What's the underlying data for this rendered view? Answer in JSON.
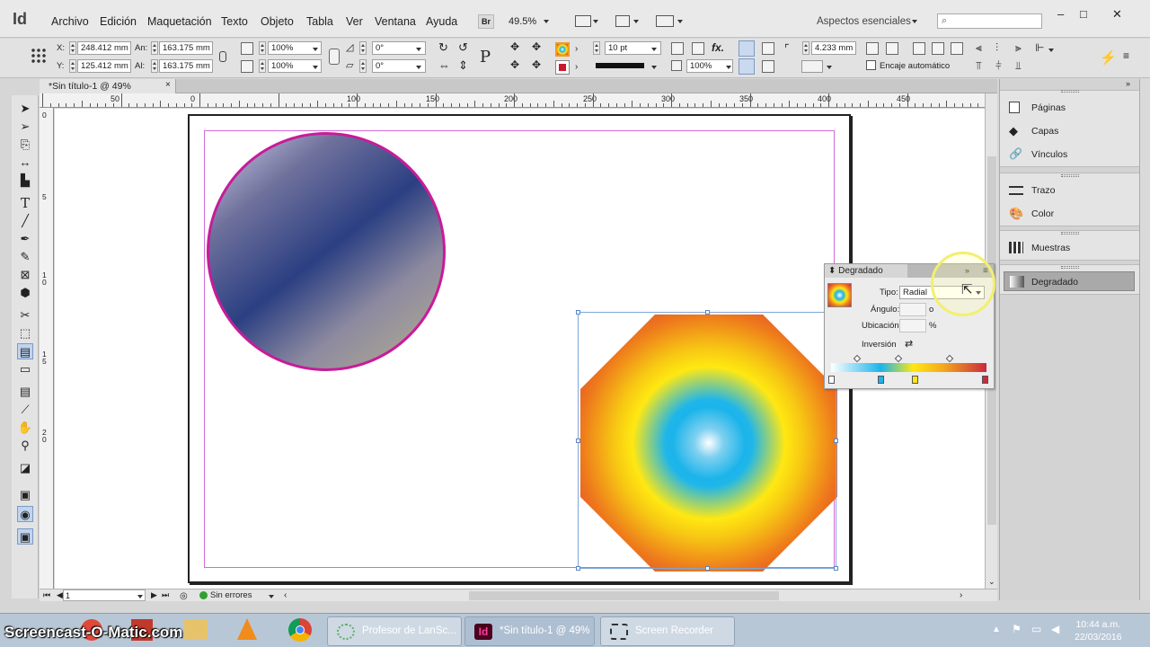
{
  "app": {
    "logo": "Id"
  },
  "menu": [
    "Archivo",
    "Edición",
    "Maquetación",
    "Texto",
    "Objeto",
    "Tabla",
    "Ver",
    "Ventana",
    "Ayuda"
  ],
  "menubar": {
    "bridge": "Br",
    "zoom": "49.5%",
    "workspace": "Aspectos esenciales",
    "search_placeholder": ""
  },
  "window_controls": {
    "minimize": "–",
    "maximize": "□",
    "close": "✕"
  },
  "control": {
    "x_label": "X:",
    "x_value": "248.412 mm",
    "y_label": "Y:",
    "y_value": "125.412 mm",
    "w_label": "An:",
    "w_value": "163.175 mm",
    "h_label": "Al:",
    "h_value": "163.175 mm",
    "scale_x": "100%",
    "scale_y": "100%",
    "rotate": "0°",
    "shear": "0°",
    "stroke_weight": "10 pt",
    "opacity": "100%",
    "offset": "4.233 mm",
    "autofit_label": "Encaje automático"
  },
  "document_tab": "*Sin título-1 @ 49%",
  "ruler_labels": [
    "0",
    "50",
    "100",
    "150",
    "200",
    "250",
    "300",
    "350",
    "400",
    "450"
  ],
  "vruler_labels": [
    "0",
    "5",
    "1 0",
    "1 5",
    "2 0"
  ],
  "status": {
    "page": "1",
    "preflight": "Sin errores"
  },
  "panels": {
    "group1": [
      "Páginas",
      "Capas",
      "Vínculos"
    ],
    "group2": [
      "Trazo",
      "Color"
    ],
    "group3": [
      "Muestras"
    ],
    "group4": [
      "Degradado"
    ]
  },
  "gradient_panel": {
    "title": "Degradado",
    "type_label": "Tipo:",
    "type_value": "Radial",
    "angle_label": "Ángulo:",
    "angle_unit": "o",
    "location_label": "Ubicación:",
    "location_unit": "%",
    "reverse_label": "Inversión"
  },
  "taskbar": {
    "watermark": "Screencast-O-Matic.com",
    "tasks": [
      "Profesor de LanSc...",
      "*Sin título-1 @ 49%",
      "Screen Recorder"
    ],
    "time": "10:44 a.m.",
    "date": "22/03/2016"
  },
  "colors": {
    "gradient_stops": [
      "#ffffff",
      "#1bb4ea",
      "#ffe812",
      "#c92a3e"
    ],
    "circle_stroke": "#c81b9a",
    "margin_guide": "#d36ad8"
  }
}
